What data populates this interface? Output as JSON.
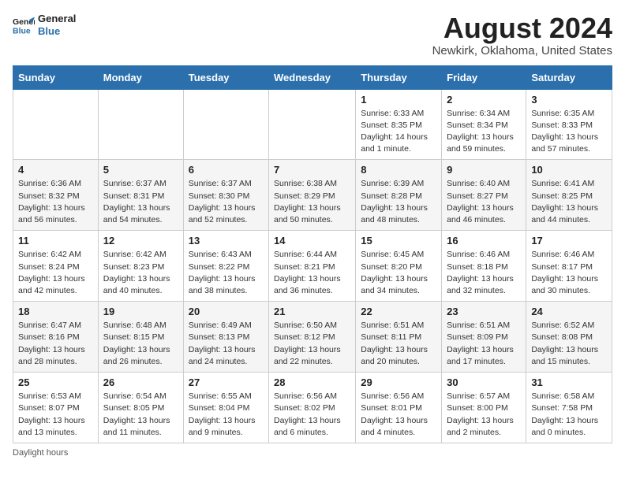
{
  "header": {
    "logo_line1": "General",
    "logo_line2": "Blue",
    "title": "August 2024",
    "subtitle": "Newkirk, Oklahoma, United States"
  },
  "days_of_week": [
    "Sunday",
    "Monday",
    "Tuesday",
    "Wednesday",
    "Thursday",
    "Friday",
    "Saturday"
  ],
  "weeks": [
    [
      {
        "day": "",
        "info": ""
      },
      {
        "day": "",
        "info": ""
      },
      {
        "day": "",
        "info": ""
      },
      {
        "day": "",
        "info": ""
      },
      {
        "day": "1",
        "info": "Sunrise: 6:33 AM\nSunset: 8:35 PM\nDaylight: 14 hours and 1 minute."
      },
      {
        "day": "2",
        "info": "Sunrise: 6:34 AM\nSunset: 8:34 PM\nDaylight: 13 hours and 59 minutes."
      },
      {
        "day": "3",
        "info": "Sunrise: 6:35 AM\nSunset: 8:33 PM\nDaylight: 13 hours and 57 minutes."
      }
    ],
    [
      {
        "day": "4",
        "info": "Sunrise: 6:36 AM\nSunset: 8:32 PM\nDaylight: 13 hours and 56 minutes."
      },
      {
        "day": "5",
        "info": "Sunrise: 6:37 AM\nSunset: 8:31 PM\nDaylight: 13 hours and 54 minutes."
      },
      {
        "day": "6",
        "info": "Sunrise: 6:37 AM\nSunset: 8:30 PM\nDaylight: 13 hours and 52 minutes."
      },
      {
        "day": "7",
        "info": "Sunrise: 6:38 AM\nSunset: 8:29 PM\nDaylight: 13 hours and 50 minutes."
      },
      {
        "day": "8",
        "info": "Sunrise: 6:39 AM\nSunset: 8:28 PM\nDaylight: 13 hours and 48 minutes."
      },
      {
        "day": "9",
        "info": "Sunrise: 6:40 AM\nSunset: 8:27 PM\nDaylight: 13 hours and 46 minutes."
      },
      {
        "day": "10",
        "info": "Sunrise: 6:41 AM\nSunset: 8:25 PM\nDaylight: 13 hours and 44 minutes."
      }
    ],
    [
      {
        "day": "11",
        "info": "Sunrise: 6:42 AM\nSunset: 8:24 PM\nDaylight: 13 hours and 42 minutes."
      },
      {
        "day": "12",
        "info": "Sunrise: 6:42 AM\nSunset: 8:23 PM\nDaylight: 13 hours and 40 minutes."
      },
      {
        "day": "13",
        "info": "Sunrise: 6:43 AM\nSunset: 8:22 PM\nDaylight: 13 hours and 38 minutes."
      },
      {
        "day": "14",
        "info": "Sunrise: 6:44 AM\nSunset: 8:21 PM\nDaylight: 13 hours and 36 minutes."
      },
      {
        "day": "15",
        "info": "Sunrise: 6:45 AM\nSunset: 8:20 PM\nDaylight: 13 hours and 34 minutes."
      },
      {
        "day": "16",
        "info": "Sunrise: 6:46 AM\nSunset: 8:18 PM\nDaylight: 13 hours and 32 minutes."
      },
      {
        "day": "17",
        "info": "Sunrise: 6:46 AM\nSunset: 8:17 PM\nDaylight: 13 hours and 30 minutes."
      }
    ],
    [
      {
        "day": "18",
        "info": "Sunrise: 6:47 AM\nSunset: 8:16 PM\nDaylight: 13 hours and 28 minutes."
      },
      {
        "day": "19",
        "info": "Sunrise: 6:48 AM\nSunset: 8:15 PM\nDaylight: 13 hours and 26 minutes."
      },
      {
        "day": "20",
        "info": "Sunrise: 6:49 AM\nSunset: 8:13 PM\nDaylight: 13 hours and 24 minutes."
      },
      {
        "day": "21",
        "info": "Sunrise: 6:50 AM\nSunset: 8:12 PM\nDaylight: 13 hours and 22 minutes."
      },
      {
        "day": "22",
        "info": "Sunrise: 6:51 AM\nSunset: 8:11 PM\nDaylight: 13 hours and 20 minutes."
      },
      {
        "day": "23",
        "info": "Sunrise: 6:51 AM\nSunset: 8:09 PM\nDaylight: 13 hours and 17 minutes."
      },
      {
        "day": "24",
        "info": "Sunrise: 6:52 AM\nSunset: 8:08 PM\nDaylight: 13 hours and 15 minutes."
      }
    ],
    [
      {
        "day": "25",
        "info": "Sunrise: 6:53 AM\nSunset: 8:07 PM\nDaylight: 13 hours and 13 minutes."
      },
      {
        "day": "26",
        "info": "Sunrise: 6:54 AM\nSunset: 8:05 PM\nDaylight: 13 hours and 11 minutes."
      },
      {
        "day": "27",
        "info": "Sunrise: 6:55 AM\nSunset: 8:04 PM\nDaylight: 13 hours and 9 minutes."
      },
      {
        "day": "28",
        "info": "Sunrise: 6:56 AM\nSunset: 8:02 PM\nDaylight: 13 hours and 6 minutes."
      },
      {
        "day": "29",
        "info": "Sunrise: 6:56 AM\nSunset: 8:01 PM\nDaylight: 13 hours and 4 minutes."
      },
      {
        "day": "30",
        "info": "Sunrise: 6:57 AM\nSunset: 8:00 PM\nDaylight: 13 hours and 2 minutes."
      },
      {
        "day": "31",
        "info": "Sunrise: 6:58 AM\nSunset: 7:58 PM\nDaylight: 13 hours and 0 minutes."
      }
    ]
  ],
  "footer": "Daylight hours"
}
